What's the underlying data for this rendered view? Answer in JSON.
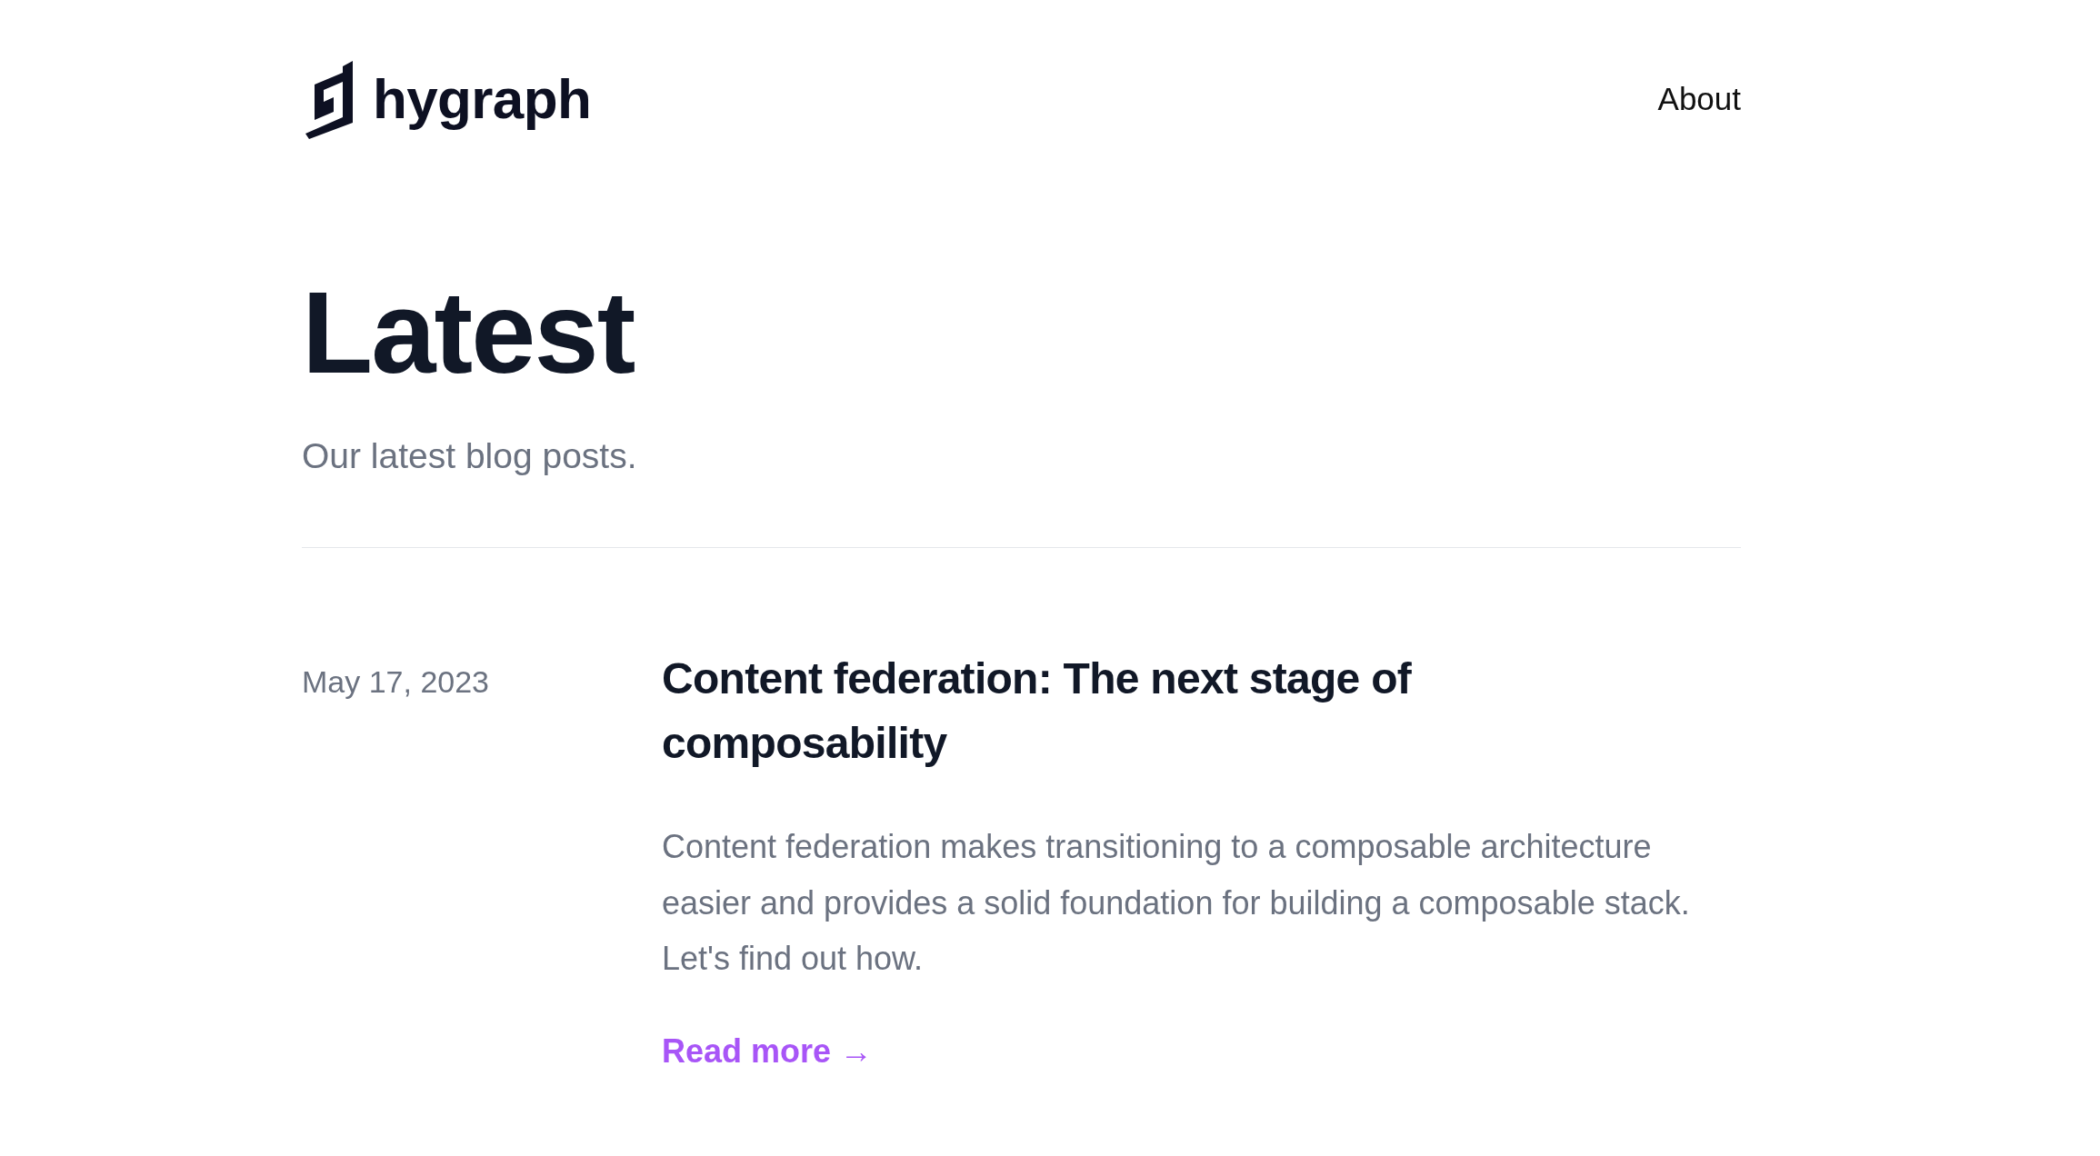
{
  "header": {
    "logo_text": "hygraph",
    "nav": [
      {
        "label": "About"
      }
    ]
  },
  "intro": {
    "title": "Latest",
    "subtitle": "Our latest blog posts."
  },
  "posts": [
    {
      "date": "May 17, 2023",
      "title": "Content federation: The next stage of composability",
      "excerpt": "Content federation makes transitioning to a composable architecture easier and provides a solid foundation for building a composable stack. Let's find out how.",
      "link": "Read more →"
    }
  ]
}
